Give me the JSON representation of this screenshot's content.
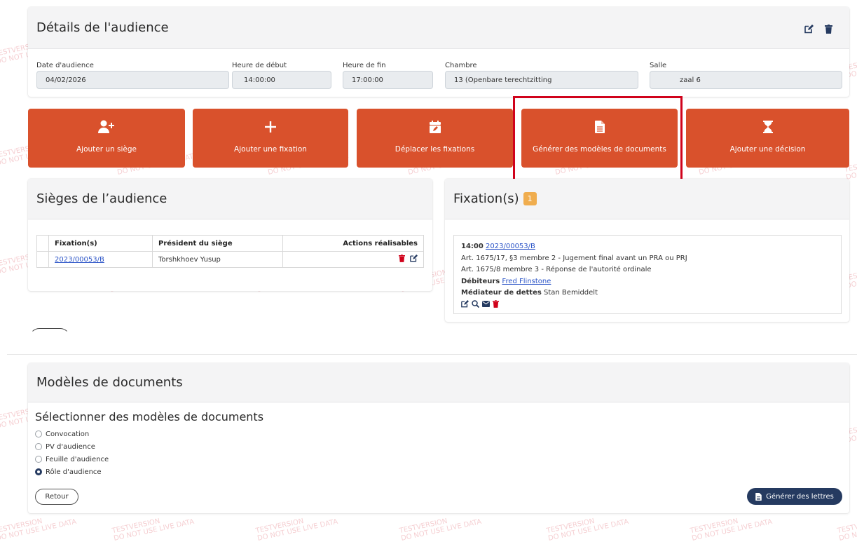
{
  "details": {
    "title": "Détails de l'audience",
    "fields": {
      "date": {
        "label": "Date d'audience",
        "value": "04/02/2026"
      },
      "start": {
        "label": "Heure de début",
        "value": "14:00:00"
      },
      "end": {
        "label": "Heure de fin",
        "value": "17:00:00"
      },
      "chamber": {
        "label": "Chambre",
        "value": "13 (Openbare terechtzitting"
      },
      "room": {
        "label": "Salle",
        "value": "zaal 6"
      }
    }
  },
  "actions": {
    "add_seat": "Ajouter un siège",
    "add_fixation": "Ajouter une fixation",
    "move_fixations": "Déplacer les fixations",
    "generate_templates": "Générer des modèles de documents",
    "add_decision": "Ajouter une décision"
  },
  "seats": {
    "title": "Sièges de l’audience",
    "columns": [
      "Fixation(s)",
      "Président du siège",
      "Actions réalisables"
    ],
    "rows": [
      {
        "fixation": "2023/00053/B",
        "president": "Torshkhoev Yusup"
      }
    ]
  },
  "fixations": {
    "title": "Fixation(s)",
    "count": "1",
    "time": "14:00",
    "case_link": "2023/00053/B",
    "line1": "Art. 1675/17, §3 membre 2 - Jugement final avant un PRA ou PRJ",
    "line2": "Art. 1675/8 membre 3 - Réponse de l'autorité ordinale",
    "debtors_label": "Débiteurs",
    "debtor": "Fred Flinstone",
    "mediator_label": "Médiateur de dettes",
    "mediator": "Stan Bemiddelt"
  },
  "templates": {
    "title": "Modèles de documents",
    "subtitle": "Sélectionner des modèles de documents",
    "options": [
      "Convocation",
      "PV d'audience",
      "Feuille d'audience",
      "Rôle d'audience"
    ],
    "selected": "Rôle d'audience",
    "back": "Retour",
    "generate": "Générer des lettres"
  },
  "watermark": {
    "line1": "TESTVERSION",
    "line2": "DO NOT USE LIVE DATA"
  },
  "colors": {
    "accent": "#d9512c",
    "highlight_border": "#d0021b",
    "badge": "#f0ad4e",
    "primary": "#253a60",
    "delete": "#d0021b"
  }
}
